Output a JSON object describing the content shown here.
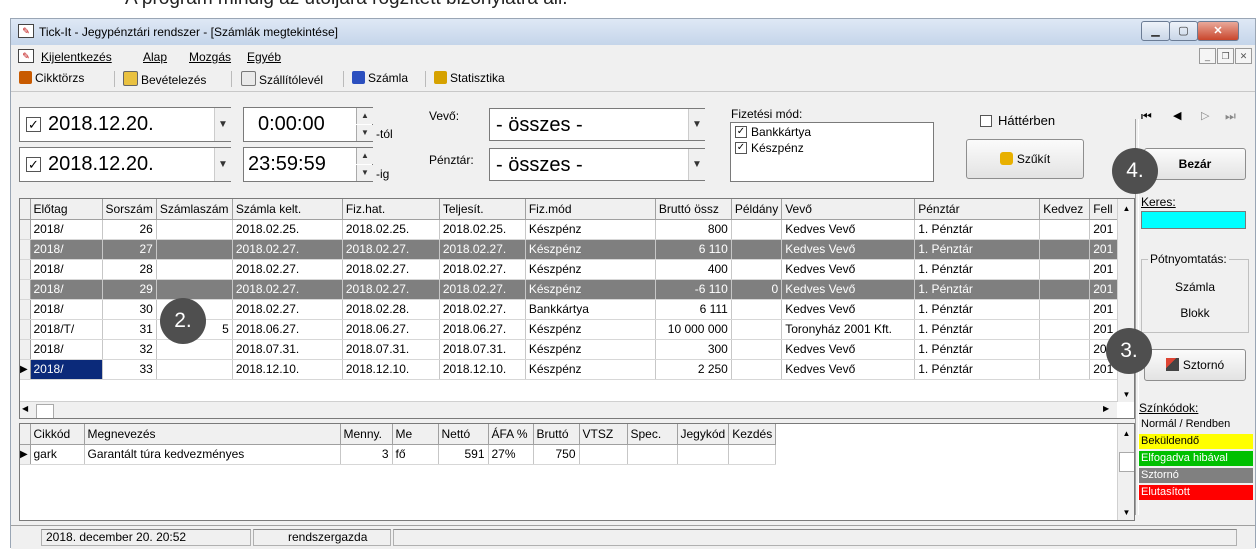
{
  "caption": "A program mindig az utoljára rögzített bizonylatra áll.",
  "window": {
    "title": "Tick-It  -  Jegypénztári rendszer - [Számlák megtekintése]"
  },
  "menu": [
    {
      "label": "Kijelentkezés"
    },
    {
      "label": "Alap"
    },
    {
      "label": "Mozgás"
    },
    {
      "label": "Egyéb"
    }
  ],
  "toolbar": [
    {
      "label": "Cikktörzs"
    },
    {
      "label": "Bevételezés"
    },
    {
      "label": "Szállítólevél"
    },
    {
      "label": "Számla"
    },
    {
      "label": "Statisztika"
    }
  ],
  "filter": {
    "date_from": "2018.12.20.",
    "time_from": "0:00:00",
    "suffix_from": "-tól",
    "date_to": "2018.12.20.",
    "time_to": "23:59:59",
    "suffix_to": "-ig",
    "buyer_label": "Vevő:",
    "buyer_value": "- összes -",
    "register_label": "Pénztár:",
    "register_value": "- összes -",
    "payment_label": "Fizetési mód:",
    "payment_options": [
      {
        "label": "Bankkártya",
        "checked": true
      },
      {
        "label": "Készpénz",
        "checked": true
      }
    ],
    "background_label": "Háttérben",
    "narrow_button": "Szűkít"
  },
  "invoice_columns": [
    "Előtag",
    "Sorszám",
    "Számlaszám",
    "Számla kelt.",
    "Fiz.hat.",
    "Teljesít.",
    "Fiz.mód",
    "Bruttó össz",
    "Példány",
    "Vevő",
    "Pénztár",
    "Kedvez",
    "Fell"
  ],
  "invoices": [
    {
      "prefix": "2018/",
      "no": "26",
      "invno": "",
      "issued": "2018.02.25.",
      "due": "2018.02.25.",
      "perf": "2018.02.25.",
      "pay": "Készpénz",
      "gross": "800",
      "copies": "",
      "buyer": "Kedves Vevő",
      "register": "1. Pénztár",
      "disc": "",
      "fell": "201",
      "storno": false
    },
    {
      "prefix": "2018/",
      "no": "27",
      "invno": "",
      "issued": "2018.02.27.",
      "due": "2018.02.27.",
      "perf": "2018.02.27.",
      "pay": "Készpénz",
      "gross": "6 110",
      "copies": "",
      "buyer": "Kedves Vevő",
      "register": "1. Pénztár",
      "disc": "",
      "fell": "201",
      "storno": true
    },
    {
      "prefix": "2018/",
      "no": "28",
      "invno": "",
      "issued": "2018.02.27.",
      "due": "2018.02.27.",
      "perf": "2018.02.27.",
      "pay": "Készpénz",
      "gross": "400",
      "copies": "",
      "buyer": "Kedves Vevő",
      "register": "1. Pénztár",
      "disc": "",
      "fell": "201",
      "storno": false
    },
    {
      "prefix": "2018/",
      "no": "29",
      "invno": "",
      "issued": "2018.02.27.",
      "due": "2018.02.27.",
      "perf": "2018.02.27.",
      "pay": "Készpénz",
      "gross": "-6 110",
      "copies": "0",
      "buyer": "Kedves Vevő",
      "register": "1. Pénztár",
      "disc": "",
      "fell": "201",
      "storno": true
    },
    {
      "prefix": "2018/",
      "no": "30",
      "invno": "",
      "issued": "2018.02.27.",
      "due": "2018.02.28.",
      "perf": "2018.02.27.",
      "pay": "Bankkártya",
      "gross": "6 111",
      "copies": "",
      "buyer": "Kedves Vevő",
      "register": "1. Pénztár",
      "disc": "",
      "fell": "201",
      "storno": false
    },
    {
      "prefix": "2018/T/",
      "no": "31",
      "invno": "5",
      "issued": "2018.06.27.",
      "due": "2018.06.27.",
      "perf": "2018.06.27.",
      "pay": "Készpénz",
      "gross": "10 000 000",
      "copies": "",
      "buyer": "Toronyház 2001 Kft.",
      "register": "1. Pénztár",
      "disc": "",
      "fell": "201",
      "storno": false
    },
    {
      "prefix": "2018/",
      "no": "32",
      "invno": "",
      "issued": "2018.07.31.",
      "due": "2018.07.31.",
      "perf": "2018.07.31.",
      "pay": "Készpénz",
      "gross": "300",
      "copies": "",
      "buyer": "Kedves Vevő",
      "register": "1. Pénztár",
      "disc": "",
      "fell": "201",
      "storno": false
    },
    {
      "prefix": "2018/",
      "no": "33",
      "invno": "",
      "issued": "2018.12.10.",
      "due": "2018.12.10.",
      "perf": "2018.12.10.",
      "pay": "Készpénz",
      "gross": "2 250",
      "copies": "",
      "buyer": "Kedves Vevő",
      "register": "1. Pénztár",
      "disc": "",
      "fell": "201",
      "storno": false,
      "selected": true
    }
  ],
  "item_columns": [
    "Cikkód",
    "Megnevezés",
    "Menny.",
    "Me",
    "Nettó",
    "ÁFA %",
    "Bruttó",
    "VTSZ",
    "Spec.",
    "Jegykód",
    "Kezdés"
  ],
  "items": [
    {
      "code": "gark",
      "name": "Garantált túra kedvezményes",
      "qty": "3",
      "unit": "fő",
      "net": "591",
      "vat": "27%",
      "gross": "750",
      "vtsz": "",
      "spec": "",
      "ticket": "",
      "start": ""
    }
  ],
  "side": {
    "nav_first": "⏮",
    "nav_prev": "◀",
    "nav_next": "▷",
    "nav_last": "⏭",
    "close_button": "Bezár",
    "search_label": "Keres:",
    "reprint_label": "Pótnyomtatás:",
    "reprint_invoice": "Számla",
    "reprint_receipt": "Blokk",
    "storno_button": "Sztornó",
    "legend_title": "Színkódok:",
    "legend": [
      {
        "label": "Normál / Rendben",
        "color": "#f0f0f0",
        "text": "#000000"
      },
      {
        "label": "Beküldendő",
        "color": "#ffff00",
        "text": "#000000"
      },
      {
        "label": "Elfogadva hibával",
        "color": "#00c000",
        "text": "#ffffff"
      },
      {
        "label": "Sztornó",
        "color": "#808080",
        "text": "#ffffff"
      },
      {
        "label": "Elutasított",
        "color": "#ff0000",
        "text": "#ffffff"
      }
    ]
  },
  "badges": [
    "2.",
    "3.",
    "4."
  ],
  "status": {
    "datetime": "2018. december 20.   20:52",
    "user": "rendszergazda"
  }
}
